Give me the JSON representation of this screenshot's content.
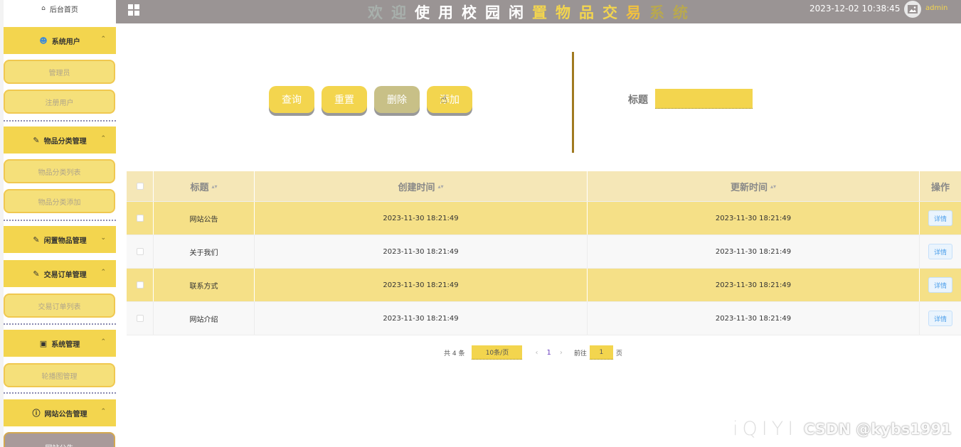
{
  "sidebar": {
    "home": "后台首页",
    "groups": [
      {
        "label": "系统用户",
        "icon": "user-icon",
        "chevron": "up",
        "items": [
          "管理员",
          "注册用户"
        ]
      },
      {
        "label": "物品分类管理",
        "icon": "edit-doc-icon",
        "chevron": "up",
        "items": [
          "物品分类列表",
          "物品分类添加"
        ]
      },
      {
        "label": "闲置物品管理",
        "icon": "edit-doc-icon",
        "chevron": "down",
        "items": []
      },
      {
        "label": "交易订单管理",
        "icon": "edit-doc-icon",
        "chevron": "up",
        "items": [
          "交易订单列表"
        ]
      },
      {
        "label": "系统管理",
        "icon": "image-icon",
        "chevron": "up",
        "items": [
          "轮播图管理"
        ]
      },
      {
        "label": "网站公告管理",
        "icon": "info-circle-icon",
        "chevron": "up",
        "items": [
          "网站公告"
        ]
      }
    ]
  },
  "header": {
    "title_chars": [
      "欢",
      "迎",
      "使",
      "用",
      "校",
      "园",
      "闲",
      "置",
      "物",
      "品",
      "交",
      "易",
      "系",
      "统"
    ],
    "title_colors": [
      "#a8b0ac",
      "#a8b0ac",
      "#ffffff",
      "#ffffff",
      "#ffffff",
      "#ffffff",
      "#ffffff",
      "#f3d54e",
      "#f3d54e",
      "#f3d54e",
      "#f3d54e",
      "#f0c040",
      "#b8a850",
      "#b8a850"
    ],
    "datetime": "2023-12-02 10:38:45",
    "username": "admin"
  },
  "search": {
    "buttons": {
      "query": "查询",
      "reset": "重置",
      "delete": "删除",
      "add": "添加"
    },
    "title_label": "标题",
    "title_value": ""
  },
  "table": {
    "columns": {
      "title": "标题",
      "created": "创建时间",
      "updated": "更新时间",
      "actions": "操作"
    },
    "rows": [
      {
        "title": "网站公告",
        "created": "2023-11-30 18:21:49",
        "updated": "2023-11-30 18:21:49",
        "action": "详情"
      },
      {
        "title": "关于我们",
        "created": "2023-11-30 18:21:49",
        "updated": "2023-11-30 18:21:49",
        "action": "详情"
      },
      {
        "title": "联系方式",
        "created": "2023-11-30 18:21:49",
        "updated": "2023-11-30 18:21:49",
        "action": "详情"
      },
      {
        "title": "网站介绍",
        "created": "2023-11-30 18:21:49",
        "updated": "2023-11-30 18:21:49",
        "action": "详情"
      }
    ]
  },
  "pagination": {
    "total": "共 4 条",
    "page_size": "10条/页",
    "current_page": "1",
    "goto_prefix": "前往",
    "goto_value": "1",
    "goto_suffix": "页"
  },
  "watermark": {
    "faint": "iQIYI",
    "csdn": "CSDN @kybs1991"
  },
  "colors": {
    "accent": "#f3d54e",
    "header_bg": "#9a9494",
    "olive": "#c8c087",
    "divider": "#a07a20",
    "link": "#4b9eea"
  }
}
